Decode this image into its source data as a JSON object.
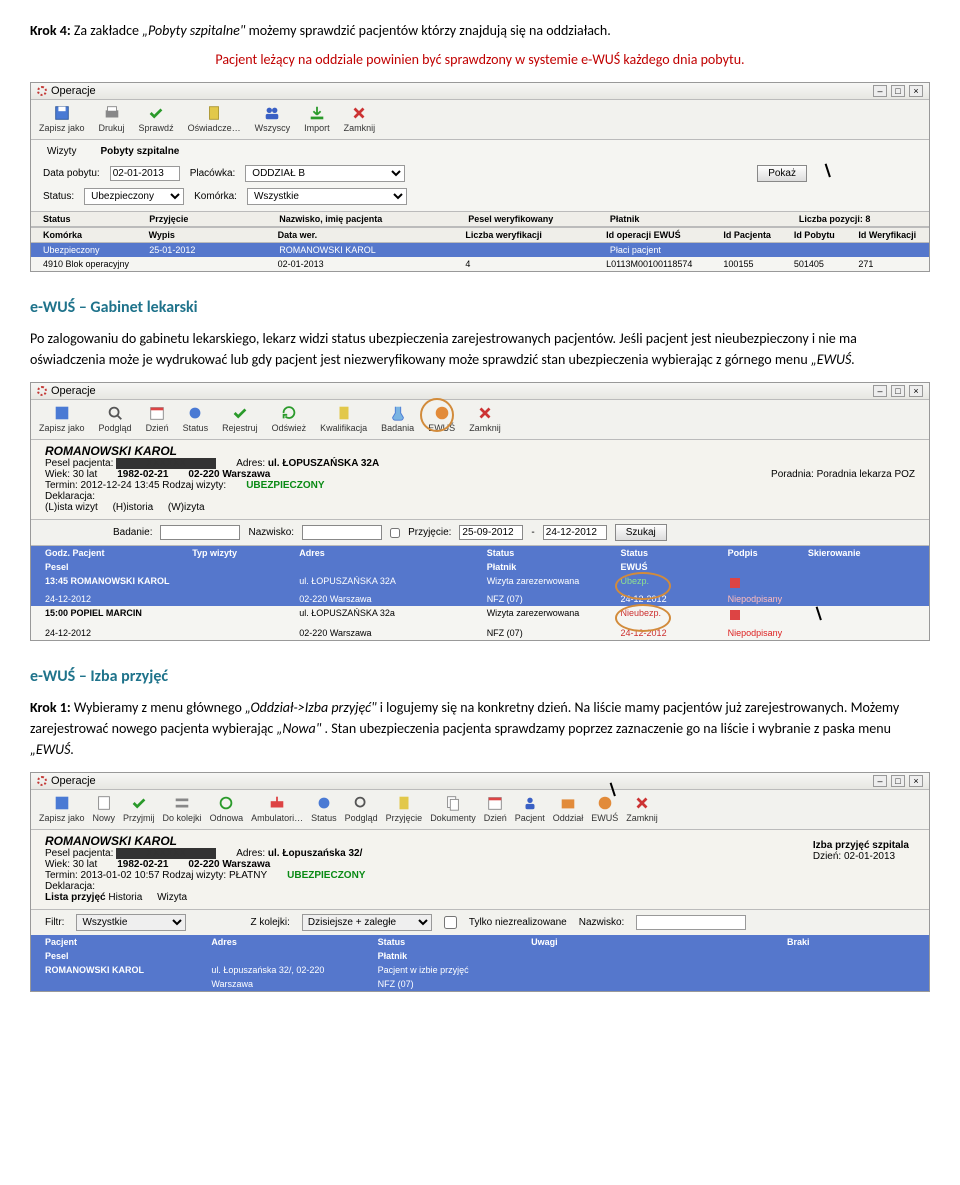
{
  "doc": {
    "p1_prefix": "Krok 4: ",
    "p1_a": "Za zakładce ",
    "p1_q1": "„Pobyty szpitalne\"",
    "p1_b": " możemy sprawdzić pacjentów którzy znajdują się na oddziałach.",
    "p2": "Pacjent leżący na oddziale powinien być sprawdzony w systemie e-WUŚ każdego dnia pobytu.",
    "s2_head": "e-WUŚ – Gabinet lekarski",
    "s2_body_a": "Po zalogowaniu do gabinetu lekarskiego, lekarz widzi status ubezpieczenia zarejestrowanych pacjentów. Jeśli pacjent jest nieubezpieczony i nie ma oświadczenia może je wydrukować lub gdy pacjent jest niezweryfikowany może sprawdzić stan ubezpieczenia wybierając z górnego menu ",
    "s2_body_q": "„EWUŚ.",
    "s3_head": "e-WUŚ – Izba przyjęć",
    "s3_k1": "Krok 1: ",
    "s3_a": "Wybieramy z menu głównego ",
    "s3_q1": "„Oddział->Izba przyjęć\"",
    "s3_b": " i logujemy się na konkretny dzień. Na liście mamy pacjentów już zarejestrowanych. Możemy zarejestrować nowego pacjenta wybierając ",
    "s3_q2": "„Nowa\"",
    "s3_c": ". Stan ubezpieczenia pacjenta sprawdzamy poprzez zaznaczenie go na liście i wybranie z paska menu ",
    "s3_q3": "„EWUŚ."
  },
  "win1": {
    "title": "Operacje",
    "toolbar": [
      "Zapisz jako",
      "Drukuj",
      "Sprawdź",
      "Oświadcze…",
      "Wszyscy",
      "Import",
      "Zamknij"
    ],
    "tabs": {
      "a": "Wizyty",
      "b": "Pobyty szpitalne"
    },
    "f": {
      "data_l": "Data pobytu:",
      "data_v": "02-01-2013",
      "plac_l": "Placówka:",
      "plac_v": "ODDZIAŁ B",
      "pokaz": "Pokaż",
      "status_l": "Status:",
      "status_v": "Ubezpieczony",
      "kom_l": "Komórka:",
      "kom_v": "Wszystkie"
    },
    "h1": [
      "Status",
      "Przyjęcie",
      "Nazwisko, imię pacjenta",
      "Pesel weryfikowany",
      "Płatnik",
      "",
      "Liczba pozycji: 8"
    ],
    "h2": [
      "Komórka",
      "Wypis",
      "Data wer.",
      "Liczba weryfikacji",
      "Id operacji EWUŚ",
      "Id Pacjenta",
      "Id Pobytu",
      "Id Weryfikacji"
    ],
    "r1": [
      "Ubezpieczony",
      "25-01-2012",
      "ROMANOWSKI KAROL",
      "",
      "Płaci pacjent",
      "",
      ""
    ],
    "r2": [
      "4910     Blok operacyjny",
      "",
      "02-01-2013",
      "4",
      "L0113M00100118574",
      "100155",
      "501405",
      "271"
    ]
  },
  "win2": {
    "title": "Operacje",
    "toolbar": [
      "Zapisz jako",
      "Podgląd",
      "Dzień",
      "Status",
      "Rejestruj",
      "Odśwież",
      "Kwalifikacja",
      "Badania",
      "EWUŚ",
      "Zamknij"
    ],
    "patient": {
      "name": "ROMANOWSKI KAROL",
      "pesel_l": "Pesel pacjenta:",
      "pesel_v": "",
      "adres_l": "Adres:",
      "adres_v1": "ul. ŁOPUSZAŃSKA 32A",
      "adres_v2": "02-220 Warszawa",
      "wiek_l": "Wiek: 30 lat",
      "ur": "1982-02-21",
      "termin": "Termin: 2012-12-24  13:45  Rodzaj wizyty:",
      "ubezp": "UBEZPIECZONY",
      "poradnia": "Poradnia: Poradnia lekarza POZ",
      "dekl": "Deklaracja:"
    },
    "subtabs": {
      "l": "(L)ista wizyt",
      "h": "(H)istoria",
      "w": "(W)izyta"
    },
    "search": {
      "bad_l": "Badanie:",
      "naz_l": "Nazwisko:",
      "ck": "Przyjęcie:",
      "d1": "25-09-2012",
      "d2": "24-12-2012",
      "btn": "Szukaj"
    },
    "cols": [
      "Godz.  Pacjent",
      "Typ wizyty",
      "Adres",
      "Status",
      "Status",
      "Podpis",
      "Skierowanie"
    ],
    "cols2": [
      "Pesel",
      "",
      "",
      "Płatnik",
      "EWUŚ",
      "",
      ""
    ],
    "rows": [
      {
        "c": [
          "13:45  ROMANOWSKI KAROL",
          "",
          "ul. ŁOPUSZAŃSKA 32A",
          "Wizyta zarezerwowana",
          "Ubezp.",
          "",
          ""
        ],
        "sub": [
          "24-12-2012",
          "",
          "02-220 Warszawa",
          "NFZ (07)",
          "24-12-2012",
          "Niepodpisany",
          ""
        ],
        "st": "ubezp"
      },
      {
        "c": [
          "15:00  POPIEL MARCIN",
          "",
          "ul. ŁOPUSZAŃSKA 32a",
          "Wizyta zarezerwowana",
          "Nieubezp.",
          "",
          ""
        ],
        "sub": [
          "24-12-2012",
          "",
          "02-220 Warszawa",
          "NFZ (07)",
          "24-12-2012",
          "Niepodpisany",
          ""
        ],
        "st": "nieubezp"
      }
    ]
  },
  "win3": {
    "title": "Operacje",
    "toolbar": [
      "Zapisz jako",
      "Nowy",
      "Przyjmij",
      "Do kolejki",
      "Odnowa",
      "Ambulatori…",
      "Status",
      "Podgląd",
      "Przyjęcie",
      "Dokumenty",
      "Dzień",
      "Pacjent",
      "Oddział",
      "EWUŚ",
      "Zamknij"
    ],
    "patient": {
      "name": "ROMANOWSKI KAROL",
      "pesel_l": "Pesel pacjenta:",
      "adres_l": "Adres:",
      "adres_v1": "ul. Łopuszańska 32/",
      "adres_v2": "02-220 Warszawa",
      "wiek_l": "Wiek: 30 lat",
      "ur": "1982-02-21",
      "termin": "Termin: 2013-01-02  10:57  Rodzaj wizyty: PŁATNY",
      "ubezp": "UBEZPIECZONY",
      "izba": "Izba przyjęć szpitala",
      "dzien": "Dzień: 02-01-2013",
      "dekl": "Deklaracja:"
    },
    "subtabs": {
      "l": "Lista przyjęć",
      "h": "Historia",
      "w": "Wizyta"
    },
    "filters": {
      "filtr_l": "Filtr:",
      "filtr_v": "Wszystkie",
      "kolei_l": "Z kolejki:",
      "kolei_v": "Dzisiejsze + zaległe",
      "tylko": "Tylko niezrealizowane",
      "naz_l": "Nazwisko:"
    },
    "cols": [
      "Pacjent",
      "Adres",
      "Status",
      "Uwagi",
      "Braki"
    ],
    "cols2": [
      "Pesel",
      "",
      "Płatnik",
      "",
      ""
    ],
    "row": [
      "ROMANOWSKI KAROL",
      "ul. Łopuszańska 32/, 02-220",
      "Pacjent w izbie przyjęć",
      "",
      ""
    ],
    "row2": [
      "",
      "Warszawa",
      "NFZ (07)",
      "",
      ""
    ]
  }
}
